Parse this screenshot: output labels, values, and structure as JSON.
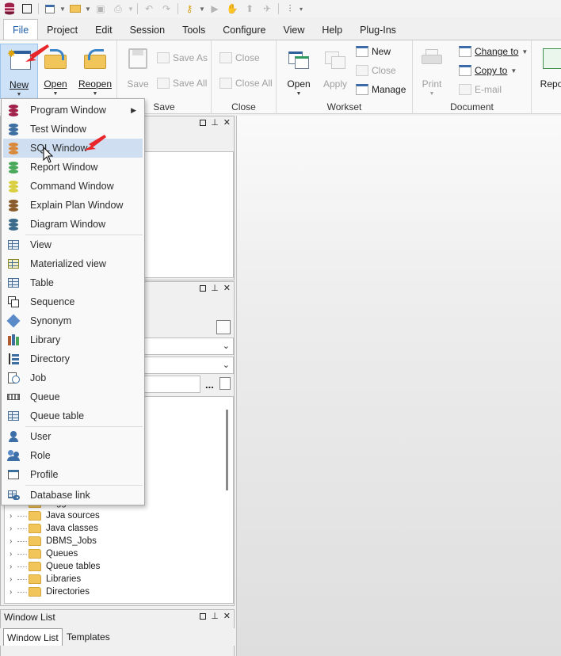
{
  "ribbon_tabs": [
    "File",
    "Project",
    "Edit",
    "Session",
    "Tools",
    "Configure",
    "View",
    "Help",
    "Plug-Ins"
  ],
  "ribbon": {
    "new_label": "New",
    "open_label": "Open",
    "reopen_label": "Reopen",
    "save_label": "Save",
    "save_as_label": "Save As",
    "save_all_label": "Save All",
    "save_group": "Save",
    "close_label": "Close",
    "close_all_label": "Close All",
    "close_group": "Close",
    "workset_open_label": "Open",
    "workset_apply_label": "Apply",
    "workset_new_label": "New",
    "workset_close_label": "Close",
    "workset_manage_label": "Manage",
    "workset_group": "Workset",
    "print_label": "Print",
    "change_to_label": "Change to",
    "copy_to_label": "Copy to",
    "email_label": "E-mail",
    "document_group": "Document",
    "report_label_partial": "Repo"
  },
  "new_menu": {
    "items": [
      {
        "label": "Program Window",
        "icon": "program-window-icon",
        "submenu": true
      },
      {
        "label": "Test Window",
        "icon": "test-window-icon"
      },
      {
        "label": "SQL Window",
        "icon": "sql-window-icon",
        "highlighted": true
      },
      {
        "label": "Report Window",
        "icon": "report-window-icon"
      },
      {
        "label": "Command Window",
        "icon": "command-window-icon"
      },
      {
        "label": "Explain Plan Window",
        "icon": "explain-plan-icon"
      },
      {
        "label": "Diagram Window",
        "icon": "diagram-window-icon"
      },
      {
        "label": "View",
        "icon": "view-icon"
      },
      {
        "label": "Materialized view",
        "icon": "materialized-view-icon"
      },
      {
        "label": "Table",
        "icon": "table-icon"
      },
      {
        "label": "Sequence",
        "icon": "sequence-icon"
      },
      {
        "label": "Synonym",
        "icon": "synonym-icon"
      },
      {
        "label": "Library",
        "icon": "library-icon"
      },
      {
        "label": "Directory",
        "icon": "directory-icon"
      },
      {
        "label": "Job",
        "icon": "job-icon"
      },
      {
        "label": "Queue",
        "icon": "queue-icon"
      },
      {
        "label": "Queue table",
        "icon": "queue-table-icon"
      },
      {
        "label": "User",
        "icon": "user-icon"
      },
      {
        "label": "Role",
        "icon": "role-icon"
      },
      {
        "label": "Profile",
        "icon": "profile-icon"
      },
      {
        "label": "Database link",
        "icon": "database-link-icon"
      }
    ]
  },
  "object_tree": {
    "items": [
      "Triggers",
      "Java sources",
      "Java classes",
      "DBMS_Jobs",
      "Queues",
      "Queue tables",
      "Libraries",
      "Directories"
    ]
  },
  "window_list": {
    "title": "Window List",
    "tabs": [
      "Window List",
      "Templates"
    ]
  },
  "panel_search": {
    "more": "..."
  },
  "colors": {
    "accent": "#1e5fa8",
    "highlight": "#cfdff1",
    "arrow": "#e8262a"
  }
}
